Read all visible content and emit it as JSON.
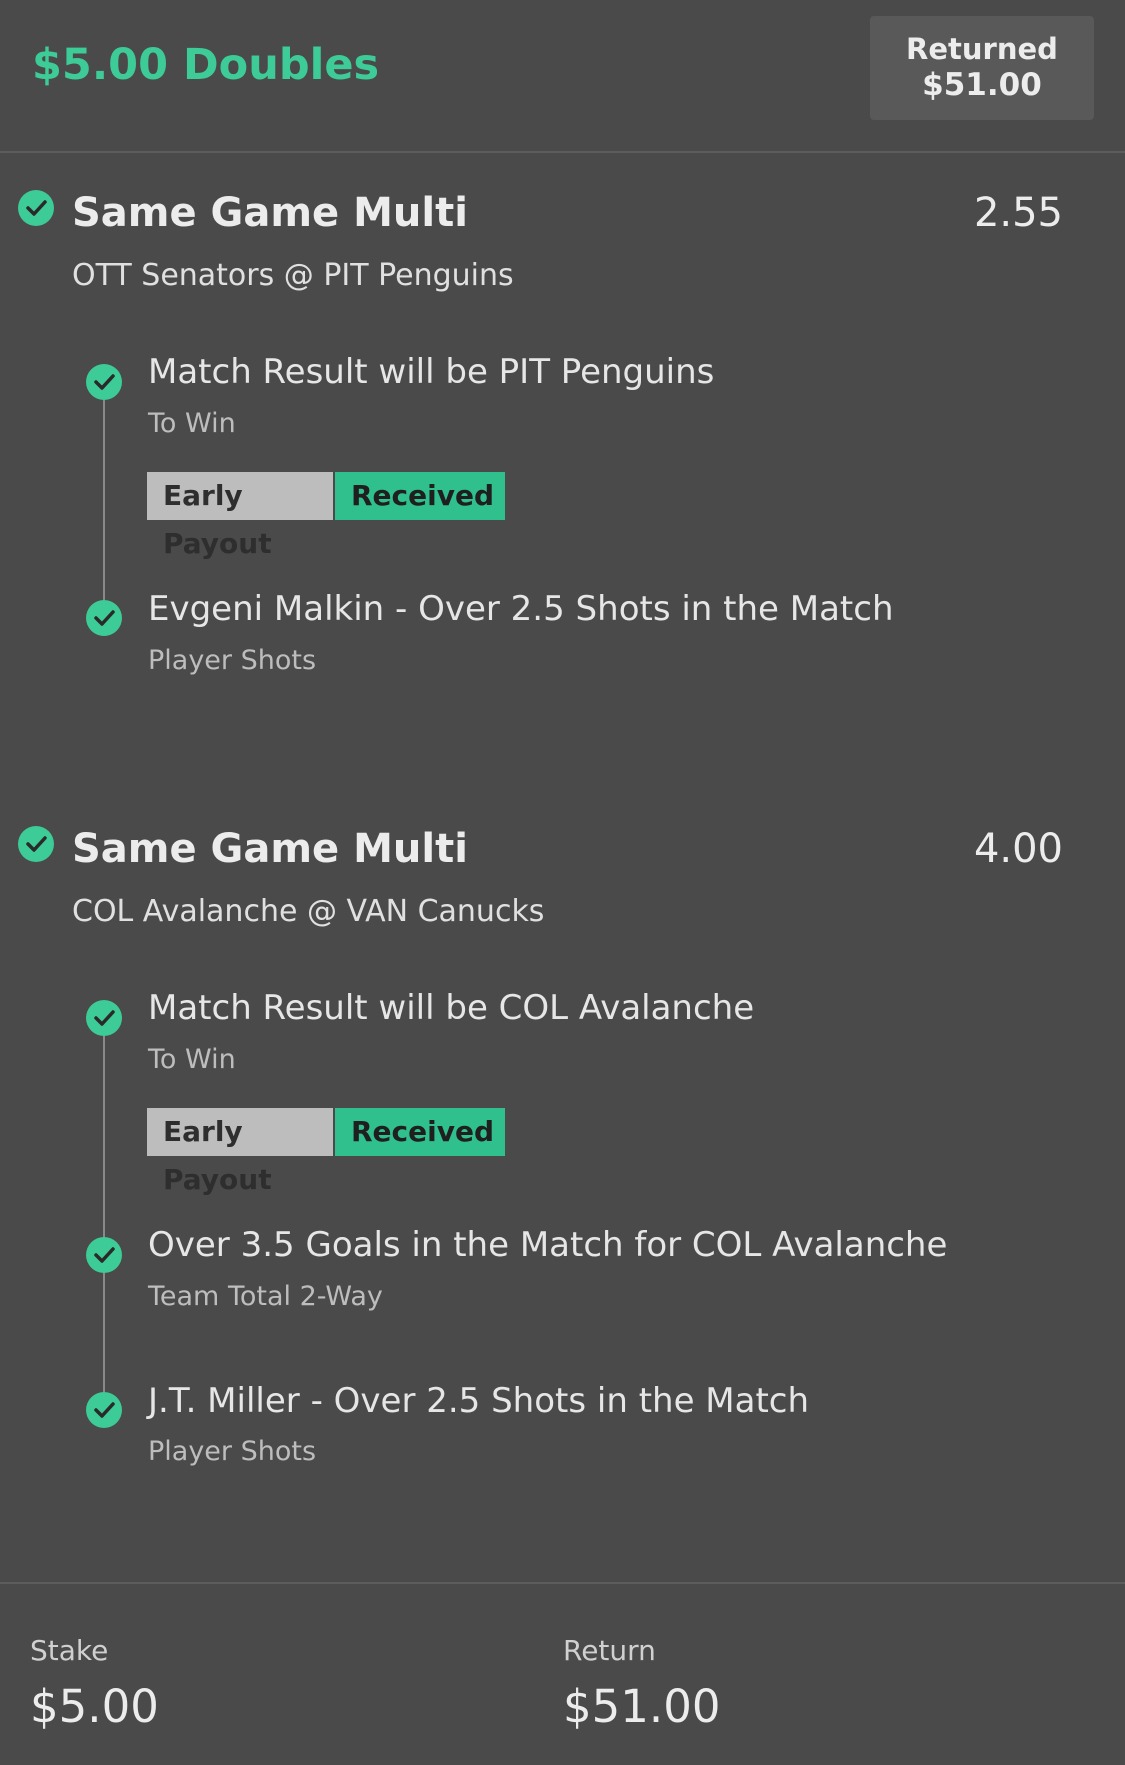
{
  "header": {
    "bet_title": "$5.00 Doubles",
    "returned_label": "Returned",
    "returned_amount": "$51.00"
  },
  "groups": [
    {
      "title": "Same Game Multi",
      "odds": "2.55",
      "matchup": "OTT Senators @ PIT Penguins",
      "legs": [
        {
          "selection": "Match Result will be PIT Penguins",
          "market": "To Win",
          "badge_left": "Early Payout",
          "badge_right": "Received"
        },
        {
          "selection": "Evgeni Malkin - Over 2.5 Shots in the Match",
          "market": "Player Shots"
        }
      ]
    },
    {
      "title": "Same Game Multi",
      "odds": "4.00",
      "matchup": "COL Avalanche @ VAN Canucks",
      "legs": [
        {
          "selection": "Match Result will be COL Avalanche",
          "market": "To Win",
          "badge_left": "Early Payout",
          "badge_right": "Received"
        },
        {
          "selection": "Over 3.5 Goals in the Match for COL Avalanche",
          "market": "Team Total 2-Way"
        },
        {
          "selection": "J.T. Miller - Over 2.5 Shots in the Match",
          "market": "Player Shots"
        }
      ]
    }
  ],
  "footer": {
    "stake_label": "Stake",
    "stake_value": "$5.00",
    "return_label": "Return",
    "return_value": "$51.00"
  },
  "colors": {
    "accent": "#3dcb97",
    "background": "#4a4a4a",
    "badge_grey": "#bdbdbd"
  },
  "icons": {
    "check": "check-circle-icon"
  }
}
